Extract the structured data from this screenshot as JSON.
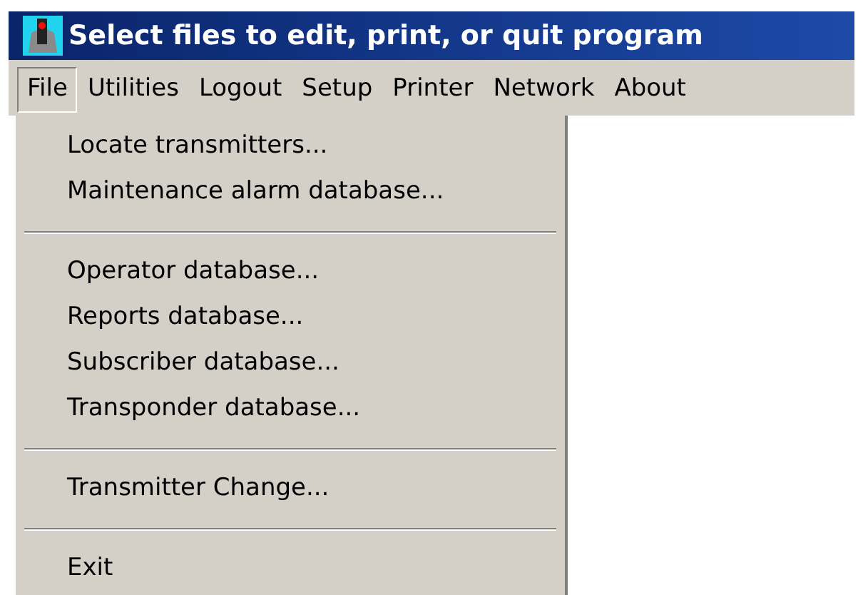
{
  "window": {
    "title": "Select files to edit, print, or quit program"
  },
  "menu_bar": [
    {
      "label": "File",
      "selected": true
    },
    {
      "label": "Utilities",
      "selected": false
    },
    {
      "label": "Logout",
      "selected": false
    },
    {
      "label": "Setup",
      "selected": false
    },
    {
      "label": "Printer",
      "selected": false
    },
    {
      "label": "Network",
      "selected": false
    },
    {
      "label": "About",
      "selected": false
    }
  ],
  "file_menu": [
    {
      "kind": "item",
      "label": "Locate transmitters..."
    },
    {
      "kind": "item",
      "label": "Maintenance alarm database..."
    },
    {
      "kind": "separator"
    },
    {
      "kind": "item",
      "label": "Operator database..."
    },
    {
      "kind": "item",
      "label": "Reports database..."
    },
    {
      "kind": "item",
      "label": "Subscriber database..."
    },
    {
      "kind": "item",
      "label": "Transponder database..."
    },
    {
      "kind": "separator"
    },
    {
      "kind": "item",
      "label": "Transmitter Change..."
    },
    {
      "kind": "separator"
    },
    {
      "kind": "item",
      "label": "Exit"
    }
  ]
}
